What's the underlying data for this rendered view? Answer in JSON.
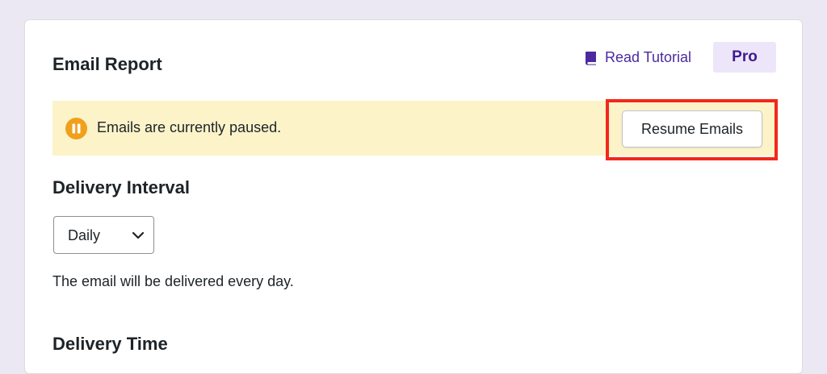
{
  "card": {
    "title": "Email Report",
    "tutorial_link": "Read Tutorial",
    "badge": "Pro"
  },
  "notice": {
    "message": "Emails are currently paused.",
    "button_label": "Resume Emails"
  },
  "delivery_interval": {
    "heading": "Delivery Interval",
    "selected": "Daily",
    "description": "The email will be delivered every day."
  },
  "delivery_time": {
    "heading": "Delivery Time"
  },
  "colors": {
    "page_background": "#ECE8F3",
    "accent_purple": "#4C2A9E",
    "notice_background": "#FCF3C9",
    "pause_icon": "#F0A01B",
    "highlight_red": "#F2281B"
  },
  "icons": {
    "tutorial": "book-icon",
    "notice": "pause-icon",
    "select": "chevron-down-icon"
  }
}
